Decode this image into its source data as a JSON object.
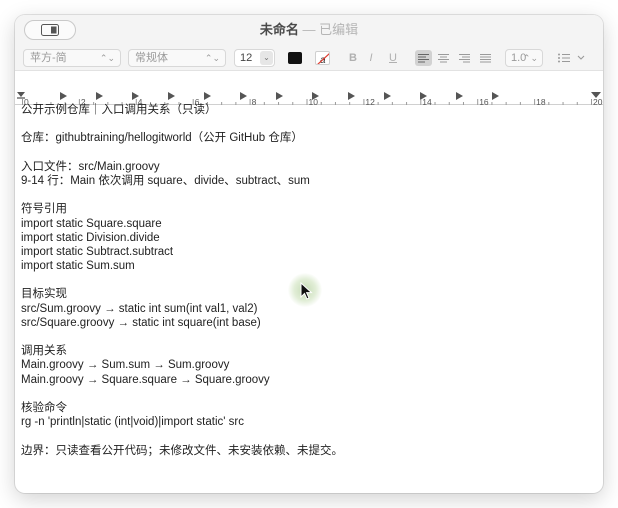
{
  "window": {
    "title": "未命名",
    "separator": "—",
    "status": "已编辑"
  },
  "toolbar": {
    "font_family": "苹方-简",
    "font_style": "常规体",
    "font_size": "12",
    "bold_label": "B",
    "italic_label": "I",
    "underline_label": "U",
    "line_spacing": "1.0",
    "text_color": "#111111"
  },
  "ruler": {
    "labels": [
      "0",
      "2",
      "4",
      "6",
      "8",
      "10",
      "12",
      "14",
      "16",
      "18",
      "20"
    ]
  },
  "document": {
    "lines": [
      "公开示例仓库｜入口调用关系（只读）",
      "",
      "仓库：githubtraining/hellogitworld（公开 GitHub 仓库）",
      "",
      "入口文件：src/Main.groovy",
      "9-14 行：Main 依次调用 square、divide、subtract、sum",
      "",
      "符号引用",
      "import static Square.square",
      "import static Division.divide",
      "import static Subtract.subtract",
      "import static Sum.sum",
      "",
      "目标实现",
      "src/Sum.groovy → static int sum(int val1, val2)",
      "src/Square.groovy → static int square(int base)",
      "",
      "调用关系",
      "Main.groovy → Sum.sum → Sum.groovy",
      "Main.groovy → Square.square → Square.groovy",
      "",
      "核验命令",
      "rg -n 'println|static (int|void)|import static' src",
      "",
      "边界：只读查看公开代码；未修改文件、未安装依赖、未提交。"
    ]
  }
}
